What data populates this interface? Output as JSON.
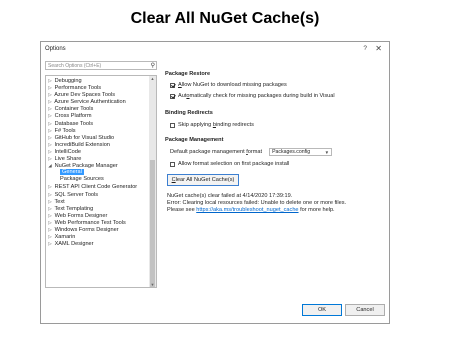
{
  "slide_title": "Clear All NuGet Cache(s)",
  "dialog": {
    "title": "Options",
    "help": "?",
    "close": "✕"
  },
  "search": {
    "placeholder": "Search Options (Ctrl+E)"
  },
  "tree": {
    "items": [
      {
        "label": "Debugging",
        "arrow": "▷"
      },
      {
        "label": "Performance Tools",
        "arrow": "▷"
      },
      {
        "label": "Azure Dev Spaces Tools",
        "arrow": "▷"
      },
      {
        "label": "Azure Service Authentication",
        "arrow": "▷"
      },
      {
        "label": "Container Tools",
        "arrow": "▷"
      },
      {
        "label": "Cross Platform",
        "arrow": "▷"
      },
      {
        "label": "Database Tools",
        "arrow": "▷"
      },
      {
        "label": "F# Tools",
        "arrow": "▷"
      },
      {
        "label": "GitHub for Visual Studio",
        "arrow": "▷"
      },
      {
        "label": "IncrediBuild Extension",
        "arrow": "▷"
      },
      {
        "label": "IntelliCode",
        "arrow": "▷"
      },
      {
        "label": "Live Share",
        "arrow": "▷"
      },
      {
        "label": "NuGet Package Manager",
        "arrow": "◢"
      },
      {
        "label": "General",
        "child": true,
        "selected": true
      },
      {
        "label": "Package Sources",
        "child": true
      },
      {
        "label": "REST API Client Code Generator",
        "arrow": "▷"
      },
      {
        "label": "SQL Server Tools",
        "arrow": "▷"
      },
      {
        "label": "Text",
        "arrow": "▷"
      },
      {
        "label": "Text Templating",
        "arrow": "▷"
      },
      {
        "label": "Web Forms Designer",
        "arrow": "▷"
      },
      {
        "label": "Web Performance Test Tools",
        "arrow": "▷"
      },
      {
        "label": "Windows Forms Designer",
        "arrow": "▷"
      },
      {
        "label": "Xamarin",
        "arrow": "▷"
      },
      {
        "label": "XAML Designer",
        "arrow": "▷"
      }
    ]
  },
  "package_restore": {
    "title": "Package Restore",
    "allow_prefix": "",
    "allow_underlined": "A",
    "allow_rest": "llow NuGet to download missing packages",
    "allow_checked": true,
    "auto_prefix": "Aut",
    "auto_underlined": "o",
    "auto_rest": "matically check for missing packages during build in Visual",
    "auto_checked": true
  },
  "binding_redirects": {
    "title": "Binding Redirects",
    "skip_prefix": "Skip applying ",
    "skip_underlined": "b",
    "skip_rest": "inding redirects",
    "skip_checked": false
  },
  "package_management": {
    "title": "Package Management",
    "default_prefix": "Default package management ",
    "default_underlined": "f",
    "default_rest": "ormat",
    "default_value": "Packages.config",
    "allow_format_label": "Allow format selection on first package install",
    "allow_format_checked": false
  },
  "clear_button": {
    "prefix": "",
    "underlined": "C",
    "rest": "lear All NuGet Cache(s)"
  },
  "status": {
    "line1": "NuGet cache(s) clear failed at 4/14/2020 17:39:19.",
    "line2": "Error: Clearing local resources failed: Unable to delete one or more files.",
    "line3_prefix": "Please see ",
    "line3_link": "https://aka.ms/troubleshoot_nuget_cache",
    "line3_suffix": " for more help."
  },
  "buttons": {
    "ok": "OK",
    "cancel": "Cancel"
  },
  "colors": {
    "selection": "#3399ff",
    "link": "#0066cc",
    "ok_border": "#0078d7"
  },
  "icons": {
    "search": "search-icon",
    "close": "close-icon",
    "expand": "chevron-right-icon",
    "expanded": "expanded-triangle-icon"
  }
}
